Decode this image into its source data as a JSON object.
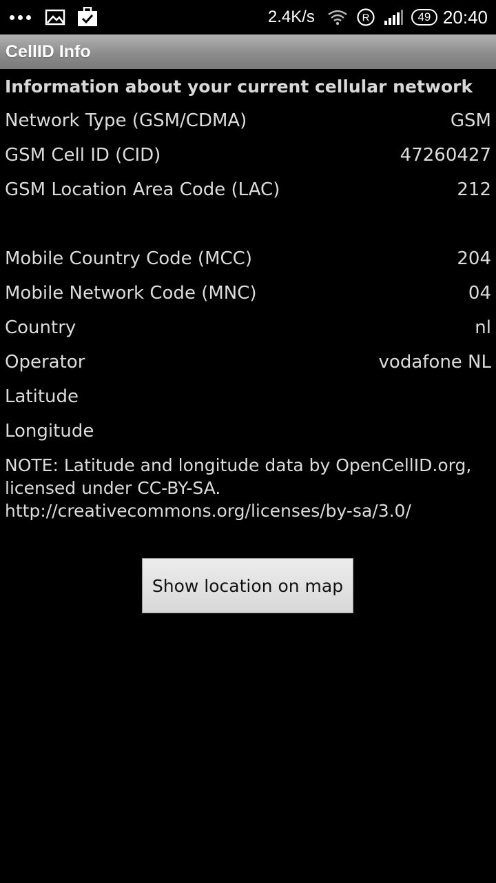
{
  "status_bar": {
    "speed": "2.4K/s",
    "battery": "49",
    "time": "20:40",
    "icons": [
      "more-dots-icon",
      "image-icon",
      "clipboard-check-icon",
      "wifi-icon",
      "roaming-r-icon",
      "signal-icon",
      "battery-icon"
    ]
  },
  "app": {
    "title": "CellID Info"
  },
  "info": {
    "heading": "Information about your current cellular network",
    "network_type": {
      "label": "Network Type (GSM/CDMA)",
      "value": "GSM"
    },
    "cell_id": {
      "label": "GSM Cell ID (CID)",
      "value": "47260427"
    },
    "lac": {
      "label": "GSM Location Area Code (LAC)",
      "value": "212"
    },
    "mcc": {
      "label": "Mobile Country Code (MCC)",
      "value": "204"
    },
    "mnc": {
      "label": "Mobile Network Code (MNC)",
      "value": "04"
    },
    "country": {
      "label": "Country",
      "value": "nl"
    },
    "operator": {
      "label": "Operator",
      "value": "vodafone NL"
    },
    "latitude": {
      "label": "Latitude",
      "value": ""
    },
    "longitude": {
      "label": "Longitude",
      "value": ""
    },
    "note_lines": [
      "NOTE: Latitude and longitude data by OpenCellID.org,",
      "licensed under CC-BY-SA.",
      "http://creativecommons.org/licenses/by-sa/3.0/"
    ]
  },
  "button": {
    "label": "Show location on map"
  },
  "colors": {
    "background": "#000000",
    "title_bar": "#9a9a9a",
    "text": "#dcdcdc",
    "button": "#e0e0e0"
  }
}
